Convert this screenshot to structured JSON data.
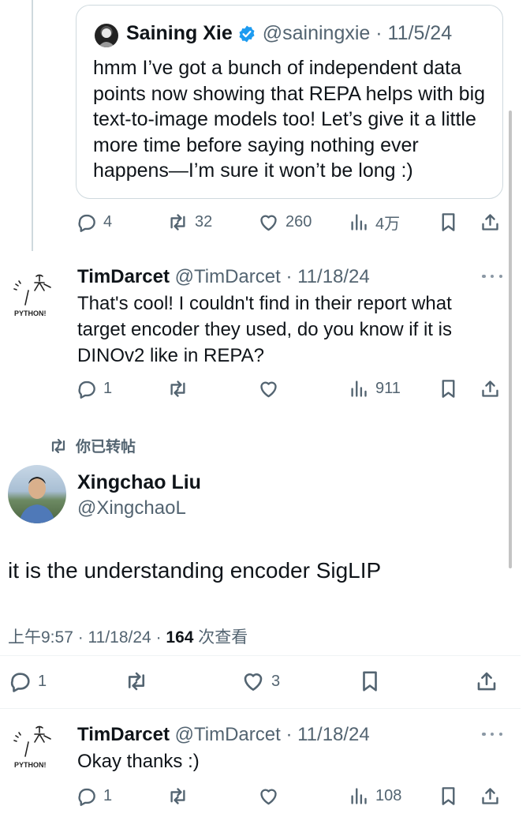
{
  "quoted_tweet": {
    "author_name": "Saining Xie",
    "handle": "@sainingxie",
    "date": "11/5/24",
    "text": "hmm I’ve got a bunch of independent data points now showing that REPA helps with big text-to-image models too! Let’s give it a little more time before saying nothing ever happens—I’m sure it won’t be long :)"
  },
  "parent_actions": {
    "replies": "4",
    "reposts": "32",
    "likes": "260",
    "views": "4万"
  },
  "reply1": {
    "author_name": "TimDarcet",
    "handle": "@TimDarcet",
    "date": "11/18/24",
    "avatar_label": "PYTHON!",
    "text": "That's cool! I couldn't find in their report what target encoder they used, do you know if it is DINOv2 like in REPA?",
    "actions": {
      "replies": "1",
      "reposts": "",
      "likes": "",
      "views": "911"
    }
  },
  "repost_note": "你已转帖",
  "main_tweet": {
    "author_name": "Xingchao Liu",
    "handle": "@XingchaoL",
    "text": "it is the understanding encoder SigLIP",
    "time": "上午9:57",
    "date": "11/18/24",
    "views_count": "164",
    "views_label": "次查看",
    "actions": {
      "replies": "1",
      "reposts": "",
      "likes": "3"
    }
  },
  "reply2": {
    "author_name": "TimDarcet",
    "handle": "@TimDarcet",
    "date": "11/18/24",
    "avatar_label": "PYTHON!",
    "text": "Okay thanks :)",
    "actions": {
      "replies": "1",
      "reposts": "",
      "likes": "",
      "views": "108"
    }
  },
  "colors": {
    "text": "#0f1419",
    "muted": "#536471",
    "verified": "#1d9bf0",
    "border": "#cfd9de"
  },
  "icons": [
    "reply-icon",
    "repost-icon",
    "like-icon",
    "views-icon",
    "bookmark-icon",
    "share-icon",
    "verified-icon",
    "more-icon"
  ]
}
